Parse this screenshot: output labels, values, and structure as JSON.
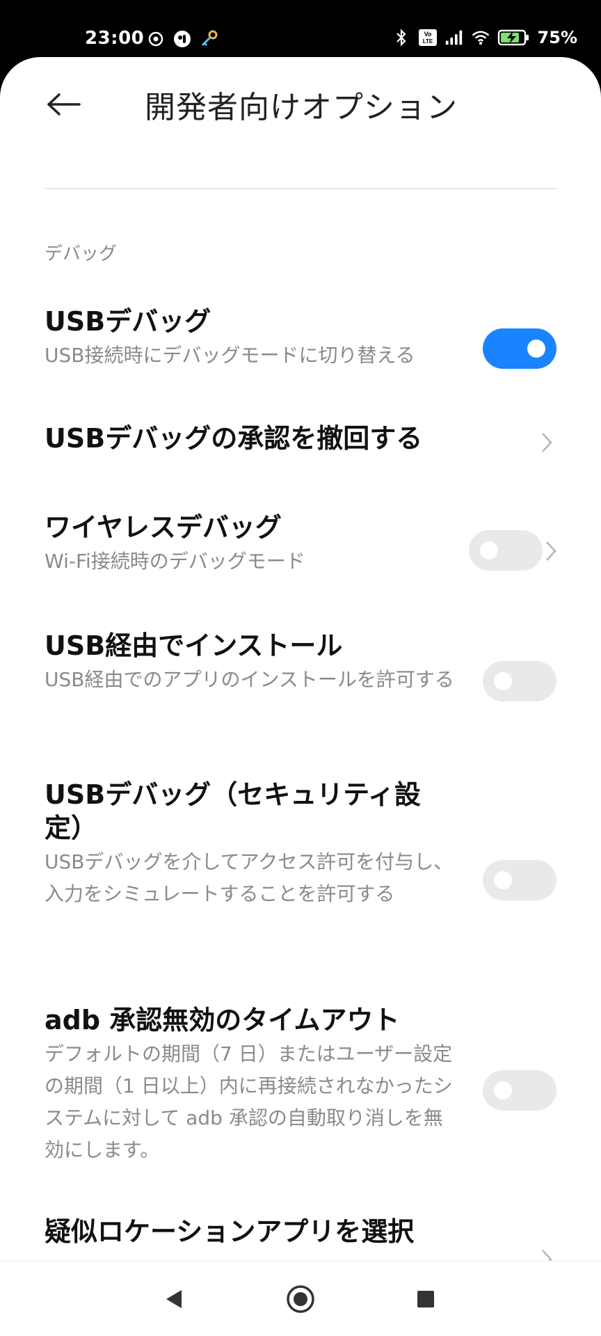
{
  "status_bar": {
    "time": "23:00",
    "battery_percent": "75%",
    "left_icons": [
      "notification-icon",
      "app-icon",
      "key-icon"
    ],
    "right_icons": [
      "bluetooth-icon",
      "volte-icon",
      "signal-icon",
      "wifi-icon",
      "battery-charging-icon"
    ]
  },
  "header": {
    "title": "開発者向けオプション",
    "back_icon": "arrow-left-icon"
  },
  "section": {
    "label": "デバッグ"
  },
  "items": [
    {
      "title": "USBデバッグ",
      "subtitle": "USB接続時にデバッグモードに切り替える",
      "control": "toggle",
      "state": "on"
    },
    {
      "title": "USBデバッグの承認を撤回する",
      "subtitle": "",
      "control": "chevron"
    },
    {
      "title": "ワイヤレスデバッグ",
      "subtitle": "Wi-Fi接続時のデバッグモード",
      "control": "toggle+chevron",
      "state": "off"
    },
    {
      "title": "USB経由でインストール",
      "subtitle": "USB経由でのアプリのインストールを許可する",
      "control": "toggle",
      "state": "off"
    },
    {
      "title": "USBデバッグ（セキュリティ設定）",
      "subtitle": "USBデバッグを介してアクセス許可を付与し、入力をシミュレートすることを許可する",
      "control": "toggle",
      "state": "off"
    },
    {
      "title": "adb 承認無効のタイムアウト",
      "subtitle": "デフォルトの期間（7 日）またはユーザー設定の期間（1 日以上）内に再接続されなかったシステムに対して adb 承認の自動取り消しを無効にします。",
      "control": "toggle",
      "state": "off"
    },
    {
      "title": "疑似ロケーションアプリを選択",
      "subtitle": "",
      "control": "chevron"
    }
  ],
  "navbar": {
    "icons": [
      "back-triangle-icon",
      "home-circle-icon",
      "recents-square-icon"
    ]
  },
  "colors": {
    "accent": "#1a83ff",
    "toggle_off": "#e9e9e9",
    "subtitle": "#8a8a8a"
  }
}
